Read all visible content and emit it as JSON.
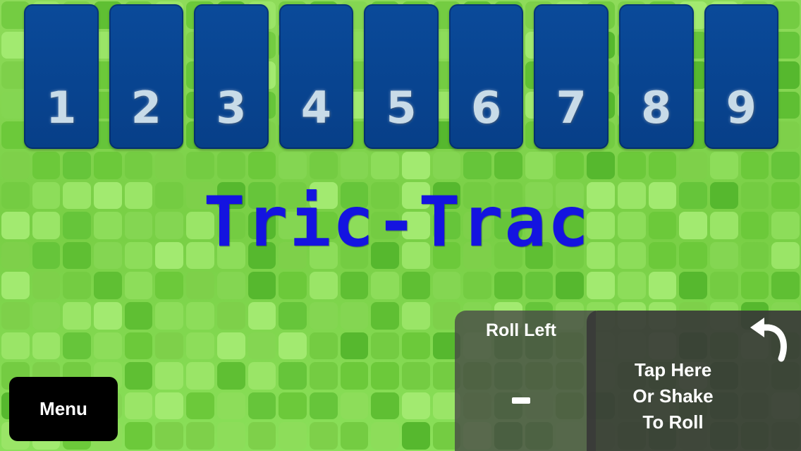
{
  "cards": [
    "1",
    "2",
    "3",
    "4",
    "5",
    "6",
    "7",
    "8",
    "9"
  ],
  "title": "Tric-Trac",
  "menu": {
    "label": "Menu"
  },
  "roll_left": {
    "label": "Roll Left",
    "value": "-"
  },
  "roll_button": {
    "lines": [
      "Tap Here",
      "Or Shake",
      "To Roll"
    ]
  },
  "undo": {
    "icon": "undo-arrow-icon"
  },
  "colors": {
    "card": "#073f88",
    "card_number": "#c8dbe8",
    "title": "#1414e0",
    "background": "#7fd24a"
  }
}
